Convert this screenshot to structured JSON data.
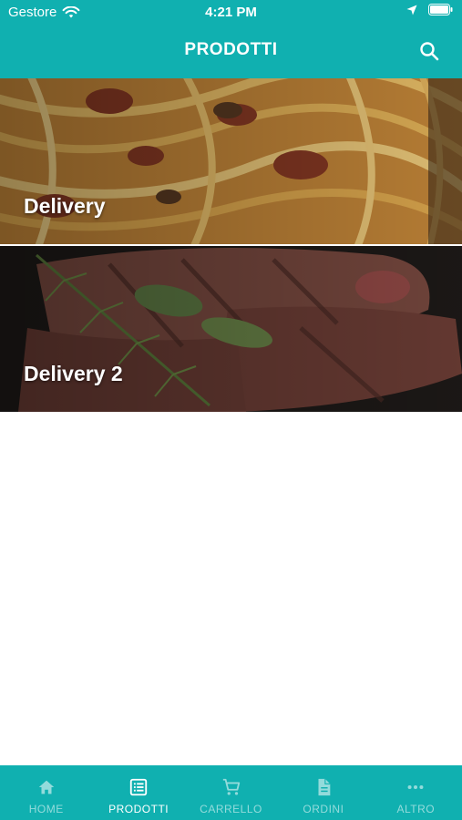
{
  "status_bar": {
    "carrier": "Gestore",
    "time": "4:21 PM"
  },
  "nav": {
    "title": "PRODOTTI",
    "search_icon": "search-icon"
  },
  "categories": [
    {
      "label": "Delivery",
      "image": "pasta-dish"
    },
    {
      "label": "Delivery 2",
      "image": "grilled-steak-with-rosemary"
    }
  ],
  "tabbar": {
    "items": [
      {
        "label": "HOME",
        "icon": "home-icon",
        "active": false
      },
      {
        "label": "PRODOTTI",
        "icon": "list-icon",
        "active": true
      },
      {
        "label": "CARRELLO",
        "icon": "cart-icon",
        "active": false
      },
      {
        "label": "ORDINI",
        "icon": "document-icon",
        "active": false
      },
      {
        "label": "ALTRO",
        "icon": "more-icon",
        "active": false
      }
    ]
  },
  "colors": {
    "primary": "#10b0b0",
    "tab_inactive": "rgba(255,255,255,0.55)",
    "tab_active": "#ffffff"
  }
}
